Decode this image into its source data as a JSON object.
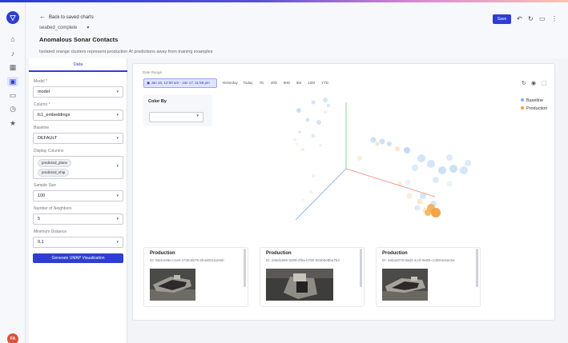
{
  "header": {
    "back_label": "Back to saved charts",
    "chart_selector": "seabed_complete",
    "title": "Anomalous Sonar Contacts",
    "subtitle": "Isolated orange clusters represent production AI predictions away from training examples",
    "save_label": "Save"
  },
  "sidebar": {
    "logo": "▽",
    "avatar": "FA",
    "icons": [
      "home-icon",
      "bell-icon",
      "dashboard-icon",
      "chart-icon",
      "folder-icon",
      "clock-icon",
      "star-icon"
    ]
  },
  "left_panel": {
    "tab": "Data",
    "model": {
      "label": "Model *",
      "value": "model"
    },
    "column": {
      "label": "Column *",
      "value": "fc1_embeddings"
    },
    "baseline": {
      "label": "Baseline",
      "value": "DEFAULT"
    },
    "display_columns": {
      "label": "Display Columns",
      "chips": [
        "predicted_plane",
        "predicted_ship"
      ]
    },
    "sample_size": {
      "label": "Sample Size",
      "value": "100"
    },
    "neighbors": {
      "label": "Number of Neighbors",
      "value": "5"
    },
    "min_distance": {
      "label": "Minimum Distance",
      "value": "0.1"
    },
    "generate_label": "Generate UMAP Visualization"
  },
  "main": {
    "date_range_label": "Date Range",
    "date_range_value": "Jan 16, 12:00 am - Jan 17, 11:59 pm",
    "quick_dates": [
      "Yesterday",
      "Today",
      "7D",
      "30D",
      "90D",
      "6M",
      "12M",
      "YTD"
    ],
    "color_by_label": "Color By",
    "color_by_value": "",
    "legend": [
      {
        "name": "Baseline",
        "color": "#7fb3e6"
      },
      {
        "name": "Production",
        "color": "#f0a040"
      }
    ],
    "cards": [
      {
        "title": "Production",
        "id": "ID: 59cb449e-c1e9-4745-8b79-2b4d041a20eb"
      },
      {
        "title": "Production",
        "id": "ID: d48d1869-5289-4f6a-b780-92eb0e8ba754"
      },
      {
        "title": "Production",
        "id": "ID: e6ba2079-9ad2-4c1f-9e89-cc3b04c6ac5a"
      }
    ]
  }
}
